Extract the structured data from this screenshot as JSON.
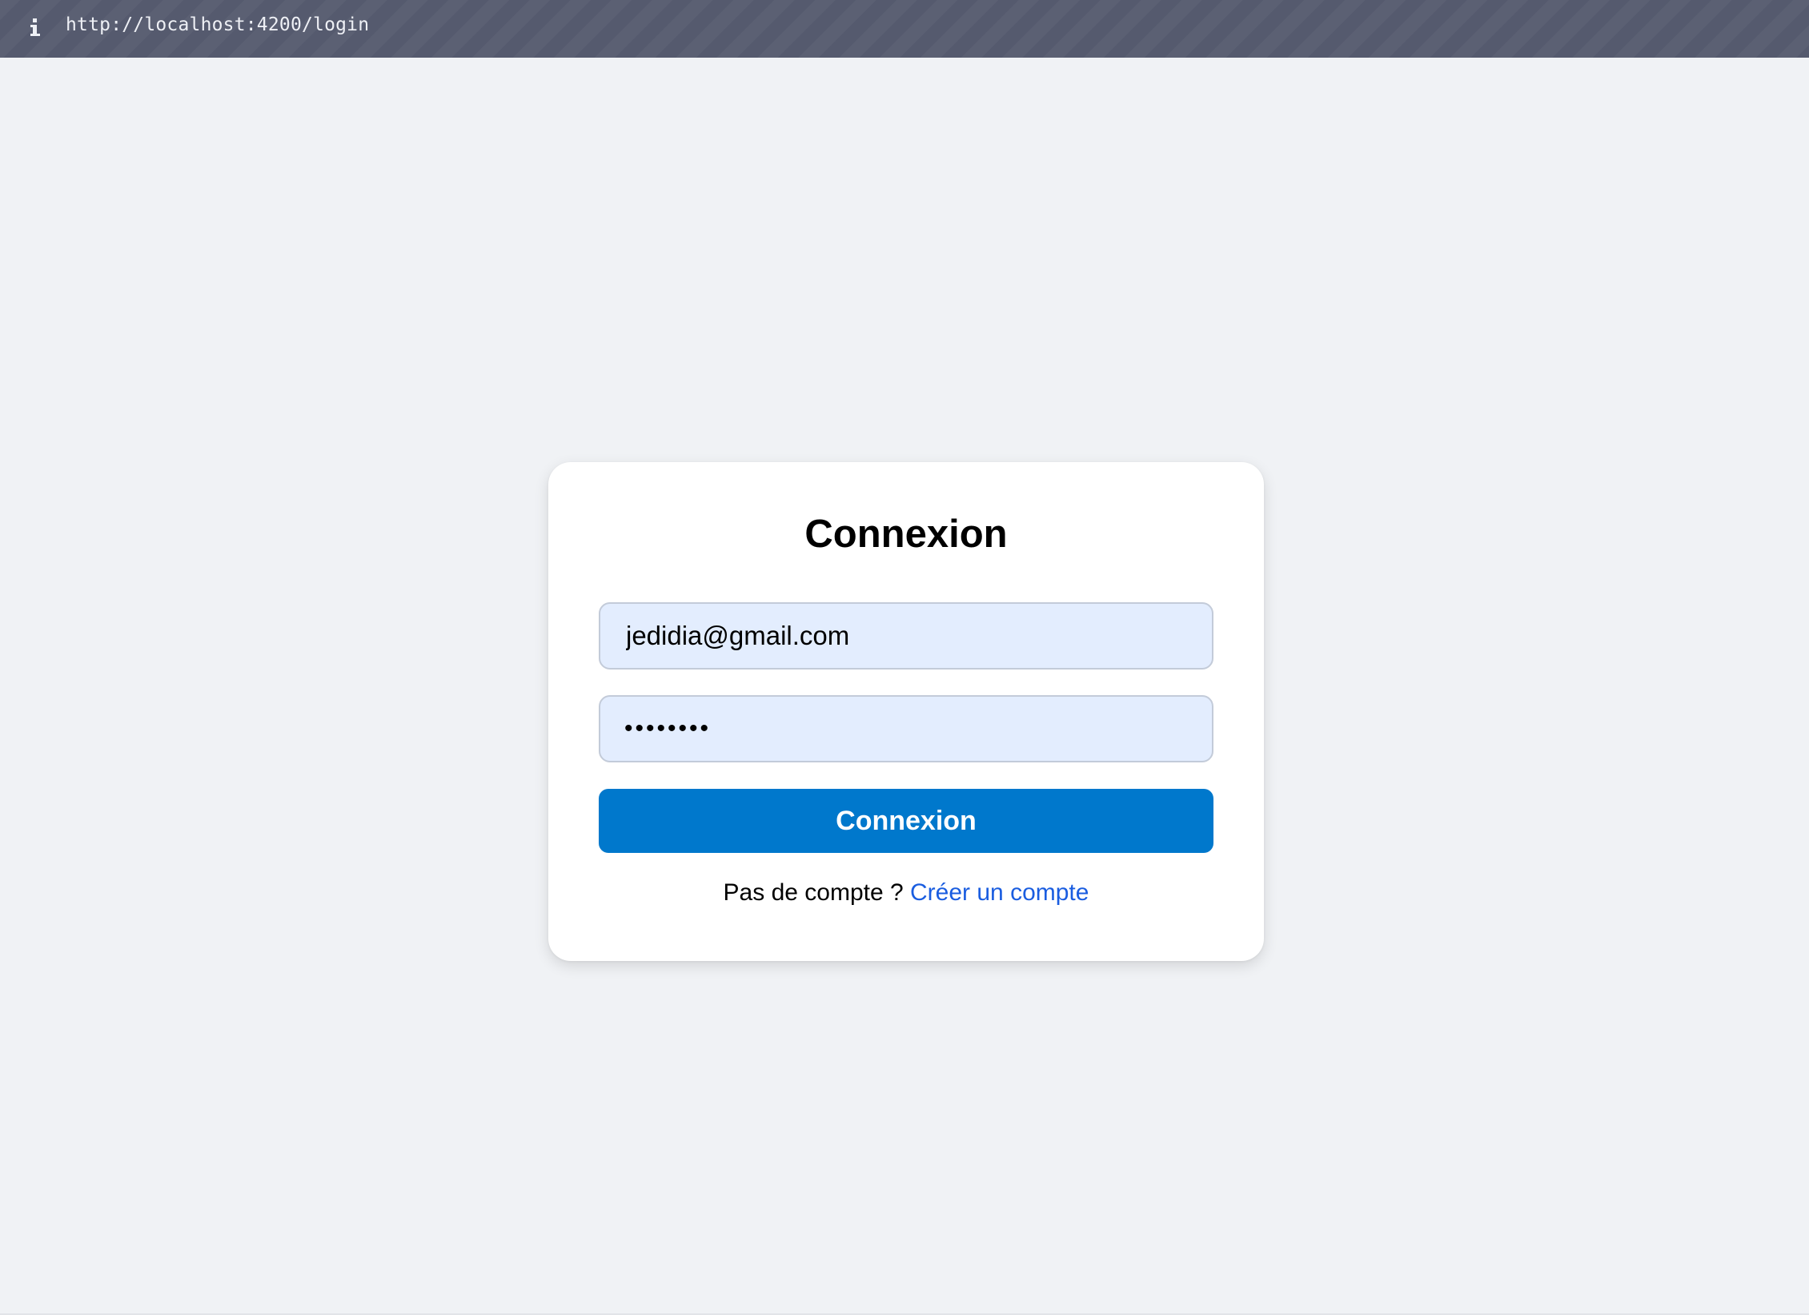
{
  "browser": {
    "info_icon": "info-icon",
    "url": "http://localhost:4200/login"
  },
  "login": {
    "title": "Connexion",
    "email_value": "jedidia@gmail.com",
    "password_masked": "••••••••",
    "submit_label": "Connexion",
    "signup_prompt": "Pas de compte ?",
    "signup_link_label": "Créer un compte"
  },
  "colors": {
    "background": "#f0f2f5",
    "topbar": "#555a6e",
    "input_fill": "#e3edfe",
    "button": "#0078cc",
    "link": "#1a5de0"
  }
}
